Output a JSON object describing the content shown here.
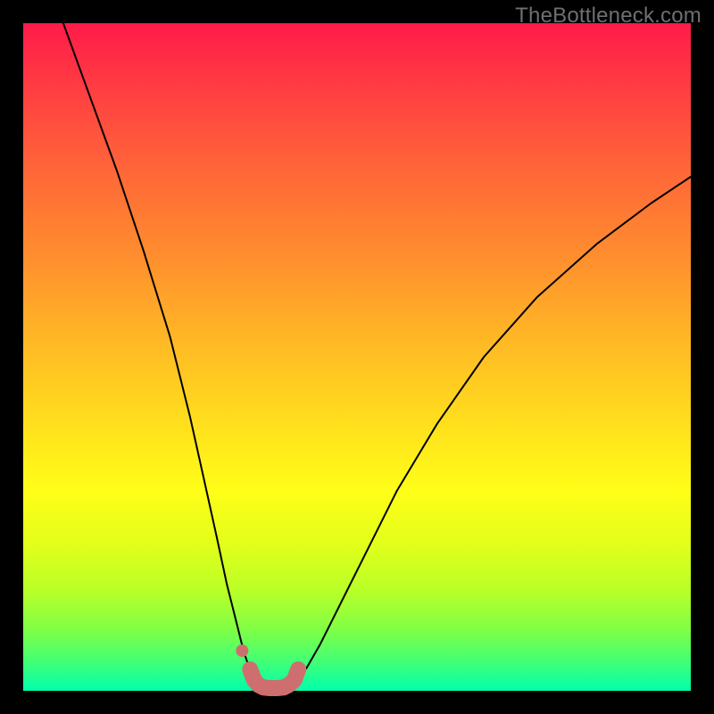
{
  "watermark": "TheBottleneck.com",
  "chart_data": {
    "type": "line",
    "title": "",
    "xlabel": "",
    "ylabel": "",
    "xlim": [
      0,
      100
    ],
    "ylim": [
      0,
      100
    ],
    "series": [
      {
        "name": "left-branch",
        "x": [
          6,
          10,
          14,
          18,
          22,
          25,
          27,
          29,
          30.5,
          32,
          33,
          34,
          34.8,
          35.4
        ],
        "values": [
          100,
          89,
          78,
          66,
          53,
          41,
          32,
          23,
          16,
          10,
          6,
          3,
          1.3,
          0.5
        ]
      },
      {
        "name": "right-branch",
        "x": [
          40,
          41,
          42.5,
          44.5,
          47,
          51,
          56,
          62,
          69,
          77,
          86,
          94,
          100
        ],
        "values": [
          0.5,
          1.5,
          3.5,
          7,
          12,
          20,
          30,
          40,
          50,
          59,
          67,
          73,
          77
        ]
      },
      {
        "name": "highlight-band",
        "x": [
          34,
          34.6,
          35.2,
          36,
          37,
          38,
          39,
          39.8,
          40.6,
          41.2
        ],
        "values": [
          3.2,
          1.6,
          0.9,
          0.5,
          0.4,
          0.4,
          0.5,
          0.9,
          1.6,
          3.2
        ]
      },
      {
        "name": "highlight-dot",
        "x": [
          32.8
        ],
        "values": [
          6.0
        ]
      }
    ],
    "colors": {
      "curve": "#000000",
      "highlight": "#cf6e6e"
    }
  }
}
